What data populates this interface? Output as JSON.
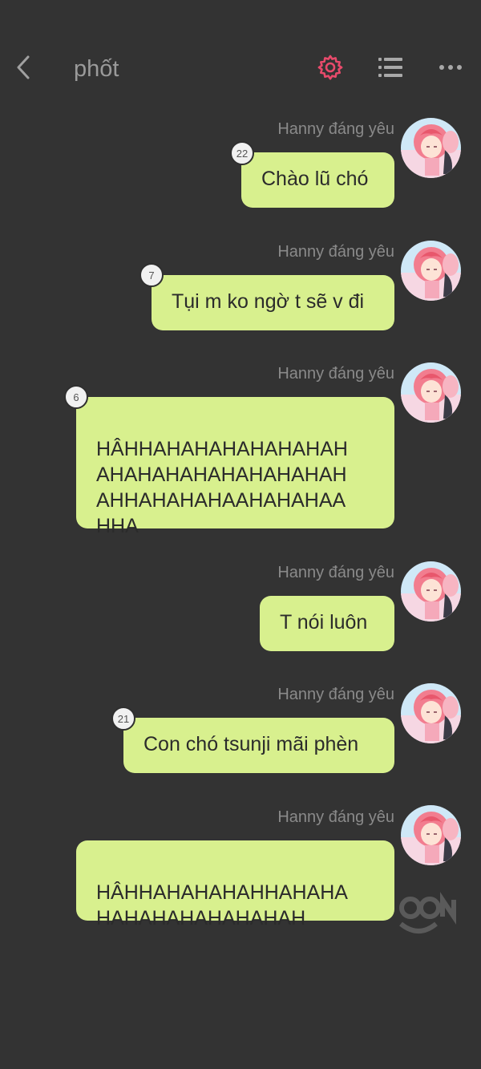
{
  "header": {
    "title": "phốt",
    "icons": [
      "back-arrow-icon",
      "gear-icon",
      "list-icon",
      "more-icon"
    ],
    "accent_color": "#e84a6b"
  },
  "messages": [
    {
      "sender": "Hanny đáng yêu",
      "text": "Chào lũ chó",
      "count": "22"
    },
    {
      "sender": "Hanny đáng yêu",
      "text": "Tụi m ko ngờ t sẽ v đi",
      "count": "7"
    },
    {
      "sender": "Hanny đáng yêu",
      "text": "HÂHHAHAHAHAHAHAHAH\nAHAHAHAHAHAHAHAHAH\nAHHAHAHAHAAHAHAHAA\nHHA",
      "count": "6"
    },
    {
      "sender": "Hanny đáng yêu",
      "text": "T nói luôn",
      "count": ""
    },
    {
      "sender": "Hanny đáng yêu",
      "text": "Con chó tsunji mãi phèn",
      "count": "21"
    },
    {
      "sender": "Hanny đáng yêu",
      "text": "HÂHHAHAHAHAHHAHAHA\nHAHAHAHAHAHAHAH",
      "count": ""
    }
  ],
  "bubble_color": "#d8f08e"
}
